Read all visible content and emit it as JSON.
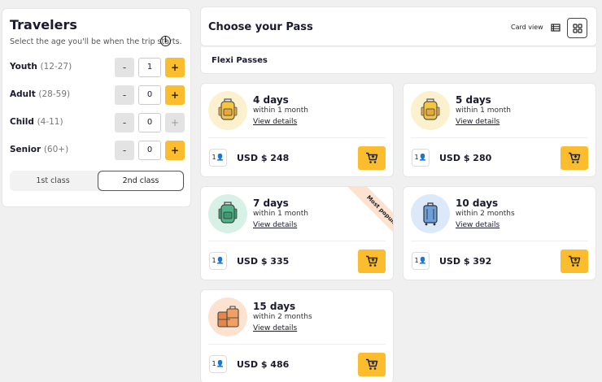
{
  "travelers": {
    "title": "Travelers",
    "subtitle": "Select the age you'll be when the trip starts.",
    "rows": [
      {
        "label": "Youth",
        "age": "(12-27)",
        "qty": "1",
        "minus": "-",
        "plus": "+",
        "plus_enabled": true
      },
      {
        "label": "Adult",
        "age": "(28-59)",
        "qty": "0",
        "minus": "-",
        "plus": "+",
        "plus_enabled": true
      },
      {
        "label": "Child",
        "age": "(4-11)",
        "qty": "0",
        "minus": "-",
        "plus": "+",
        "plus_enabled": false
      },
      {
        "label": "Senior",
        "age": "(60+)",
        "qty": "0",
        "minus": "-",
        "plus": "+",
        "plus_enabled": true
      }
    ],
    "classes": [
      "1st class",
      "2nd class"
    ],
    "selected_class": "2nd class"
  },
  "header": {
    "title": "Choose your Pass",
    "view_label": "Card view"
  },
  "section": {
    "title": "Flexi Passes"
  },
  "passes": [
    {
      "days": "4 days",
      "within": "within 1 month",
      "details": "View details",
      "pax": "1",
      "price": "USD $ 248",
      "icon": "backpack-icon"
    },
    {
      "days": "5 days",
      "within": "within 1 month",
      "details": "View details",
      "pax": "1",
      "price": "USD $ 280",
      "icon": "backpack-icon"
    },
    {
      "days": "7 days",
      "within": "within 1 month",
      "details": "View details",
      "pax": "1",
      "price": "USD $ 335",
      "icon": "green-backpack-icon",
      "badge": "Most popular"
    },
    {
      "days": "10 days",
      "within": "within 2 months",
      "details": "View details",
      "pax": "1",
      "price": "USD $ 392",
      "icon": "suitcase-icon"
    },
    {
      "days": "15 days",
      "within": "within 2 months",
      "details": "View details",
      "pax": "1",
      "price": "USD $ 486",
      "icon": "luggage-icon"
    }
  ],
  "colors": {
    "accent": "#fbbd2d",
    "badge": "#fde2cf"
  }
}
